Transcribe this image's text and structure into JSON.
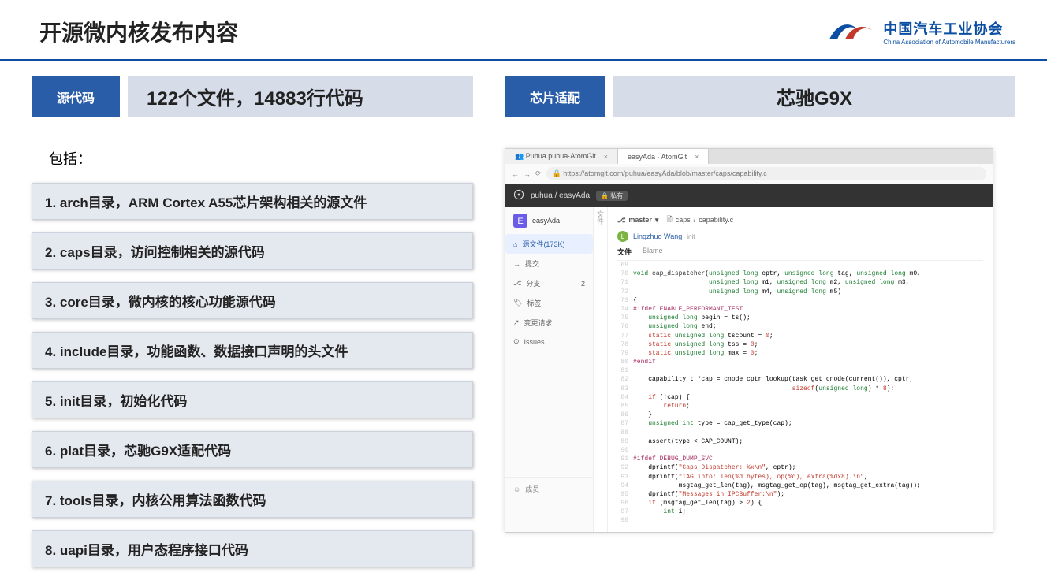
{
  "slide": {
    "title": "开源微内核发布内容",
    "org_name_cn": "中国汽车工业协会",
    "org_name_en": "China Association of Automobile Manufacturers"
  },
  "left": {
    "tag_label": "源代码",
    "tag_value": "122个文件，14883行代码",
    "includes": "包括：",
    "items": [
      "1.  arch目录，ARM Cortex A55芯片架构相关的源文件",
      "2. caps目录，访问控制相关的源代码",
      "3. core目录，微内核的核心功能源代码",
      "4. include目录，功能函数、数据接口声明的头文件",
      "5. init目录，初始化代码",
      "6. plat目录，芯驰G9X适配代码",
      "7. tools目录，内核公用算法函数代码",
      "8. uapi目录，用户态程序接口代码"
    ]
  },
  "right": {
    "tag_label": "芯片适配",
    "tag_value": "芯驰G9X"
  },
  "browser": {
    "tabs": [
      {
        "title": "👥 Puhua puhua·AtomGit",
        "active": false
      },
      {
        "title": "easyAda · AtomGit",
        "active": true
      }
    ],
    "url": "https://atomgit.com/puhua/easyAda/blob/master/caps/capability.c",
    "repo_path": "puhua / easyAda",
    "repo_badge": "🔒 私有",
    "sidebar": {
      "project": "easyAda",
      "items": [
        {
          "icon": "⌂",
          "label": "源文件(173K)",
          "active": true,
          "count": ""
        },
        {
          "icon": "→",
          "label": "提交",
          "active": false,
          "count": ""
        },
        {
          "icon": "⎇",
          "label": "分支",
          "active": false,
          "count": "2"
        },
        {
          "icon": "🏷",
          "label": "标签",
          "active": false,
          "count": ""
        },
        {
          "icon": "↗",
          "label": "变更请求",
          "active": false,
          "count": ""
        },
        {
          "icon": "⊙",
          "label": "Issues",
          "active": false,
          "count": ""
        }
      ],
      "footer": {
        "icon": "☺",
        "label": "成员"
      }
    },
    "vert_tab": "文件",
    "main": {
      "branch_icon": "⎇",
      "branch": "master",
      "breadcrumb_icon": "🗎",
      "breadcrumb": [
        "caps",
        "capability.c"
      ],
      "author": "Lingzhuo Wang",
      "author_action": "init",
      "file_tabs": [
        "文件",
        "Blame"
      ],
      "code_lines": [
        {
          "n": 69,
          "html": ""
        },
        {
          "n": 70,
          "html": "<span class='ty'>void</span> <span class='fn'>cap_dispatcher</span>(<span class='ty'>unsigned long</span> cptr, <span class='ty'>unsigned long</span> tag, <span class='ty'>unsigned long</span> m0,"
        },
        {
          "n": 71,
          "html": "                    <span class='ty'>unsigned long</span> m1, <span class='ty'>unsigned long</span> m2, <span class='ty'>unsigned long</span> m3,"
        },
        {
          "n": 72,
          "html": "                    <span class='ty'>unsigned long</span> m4, <span class='ty'>unsigned long</span> m5)"
        },
        {
          "n": 73,
          "html": "{"
        },
        {
          "n": 74,
          "html": "<span class='pp'>#ifdef ENABLE_PERFORMANT_TEST</span>"
        },
        {
          "n": 75,
          "html": "    <span class='ty'>unsigned long</span> begin = ts();"
        },
        {
          "n": 76,
          "html": "    <span class='ty'>unsigned long</span> end;"
        },
        {
          "n": 77,
          "html": "    <span class='kw'>static</span> <span class='ty'>unsigned long</span> tscount = <span class='st'>0</span>;"
        },
        {
          "n": 78,
          "html": "    <span class='kw'>static</span> <span class='ty'>unsigned long</span> tss = <span class='st'>0</span>;"
        },
        {
          "n": 79,
          "html": "    <span class='kw'>static</span> <span class='ty'>unsigned long</span> max = <span class='st'>0</span>;"
        },
        {
          "n": 80,
          "html": "<span class='pp'>#endif</span>"
        },
        {
          "n": 81,
          "html": ""
        },
        {
          "n": 82,
          "html": "    capability_t *cap = cnode_cptr_lookup(task_get_cnode(current()), cptr,"
        },
        {
          "n": 83,
          "html": "                                          <span class='kw'>sizeof</span>(<span class='ty'>unsigned long</span>) * <span class='st'>8</span>);"
        },
        {
          "n": 84,
          "html": "    <span class='kw'>if</span> (!cap) {"
        },
        {
          "n": 85,
          "html": "        <span class='kw'>return</span>;"
        },
        {
          "n": 86,
          "html": "    }"
        },
        {
          "n": 87,
          "html": "    <span class='ty'>unsigned int</span> type = cap_get_type(cap);"
        },
        {
          "n": 88,
          "html": ""
        },
        {
          "n": 89,
          "html": "    assert(type &lt; CAP_COUNT);"
        },
        {
          "n": 90,
          "html": ""
        },
        {
          "n": 91,
          "html": "<span class='pp'>#ifdef DEBUG_DUMP_SVC</span>"
        },
        {
          "n": 92,
          "html": "    dprintf(<span class='st'>\"Caps Dispatcher: %x\\n\"</span>, cptr);"
        },
        {
          "n": 93,
          "html": "    dprintf(<span class='st'>\"TAG info: len(%d bytes), op(%d), extra(%dx8).\\n\"</span>,"
        },
        {
          "n": 94,
          "html": "            msgtag_get_len(tag), msgtag_get_op(tag), msgtag_get_extra(tag));"
        },
        {
          "n": 95,
          "html": "    dprintf(<span class='st'>\"Messages in IPCBuffer:\\n\"</span>);"
        },
        {
          "n": 96,
          "html": "    <span class='kw'>if</span> (msgtag_get_len(tag) &gt; <span class='st'>2</span>) {"
        },
        {
          "n": 97,
          "html": "        <span class='ty'>int</span> i;"
        },
        {
          "n": 98,
          "html": ""
        }
      ]
    }
  }
}
